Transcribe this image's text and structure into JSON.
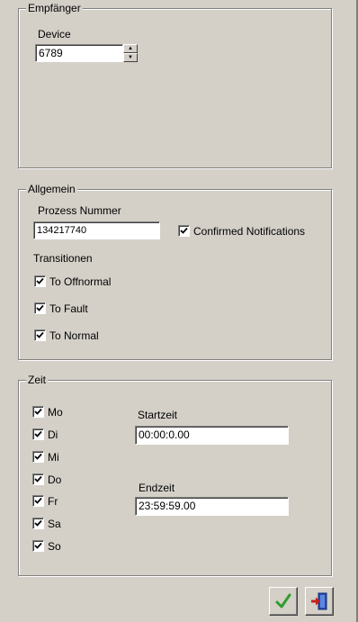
{
  "empfaenger": {
    "legend": "Empfänger",
    "device_label": "Device",
    "device_value": "6789"
  },
  "allgemein": {
    "legend": "Allgemein",
    "prozess_label": "Prozess Nummer",
    "prozess_value": "134217740",
    "confirmed_label": "Confirmed Notifications",
    "confirmed_checked": true,
    "transitionen_label": "Transitionen",
    "transitions": [
      {
        "label": "To Offnormal",
        "checked": true
      },
      {
        "label": "To Fault",
        "checked": true
      },
      {
        "label": "To Normal",
        "checked": true
      }
    ]
  },
  "zeit": {
    "legend": "Zeit",
    "days": [
      {
        "label": "Mo",
        "checked": true
      },
      {
        "label": "Di",
        "checked": true
      },
      {
        "label": "Mi",
        "checked": true
      },
      {
        "label": "Do",
        "checked": true
      },
      {
        "label": "Fr",
        "checked": true
      },
      {
        "label": "Sa",
        "checked": true
      },
      {
        "label": "So",
        "checked": true
      }
    ],
    "startzeit_label": "Startzeit",
    "startzeit_value": "00:00:0.00",
    "endzeit_label": "Endzeit",
    "endzeit_value": "23:59:59.00"
  },
  "buttons": {
    "ok_icon": "checkmark-icon",
    "exit_icon": "exit-door-icon"
  },
  "colors": {
    "background": "#d4d0c8",
    "checkmark": "#2e9e2e",
    "door": "#2a4fb0",
    "arrow": "#c8201c"
  }
}
